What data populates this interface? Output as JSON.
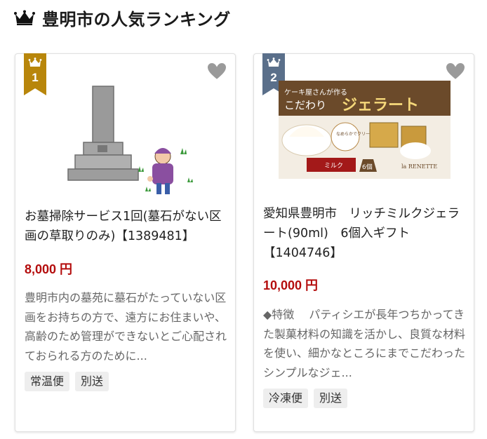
{
  "header": {
    "icon": "crown-icon",
    "title": "豊明市の人気ランキング"
  },
  "items": [
    {
      "rank": "1",
      "rank_color": "#b8860b",
      "image_alt": "grave-cleaning-illustration",
      "name": "お墓掃除サービス1回(墓石がない区画の草取りのみ)【1389481】",
      "price": "8,000 円",
      "description": "豊明市内の墓苑に墓石がたっていない区画をお持ちの方で、遠方にお住まいや、高齢のため管理ができないとご心配されておられる方のために...",
      "tags": [
        "常温便",
        "別送"
      ]
    },
    {
      "rank": "2",
      "rank_color": "#5a6f8a",
      "image_alt": "gelato-product-photo",
      "image_texts": {
        "top_small": "ケーキ屋さんが作る",
        "top_big_prefix": "こだわり",
        "top_big": "ジェラート",
        "circle": "なめらかでクリーミー",
        "flavor": "ミルク",
        "count": "6個",
        "brand": "la RENETTE"
      },
      "name": "愛知県豊明市　リッチミルクジェラート(90ml)　6個入ギフト【1404746】",
      "price": "10,000 円",
      "description": "◆特徴　 パティシエが長年つちかってきた製菓材料の知識を活かし、良質な材料を使い、細かなところにまでこだわった　 シンプルなジェ...",
      "tags": [
        "冷凍便",
        "別送"
      ]
    }
  ]
}
